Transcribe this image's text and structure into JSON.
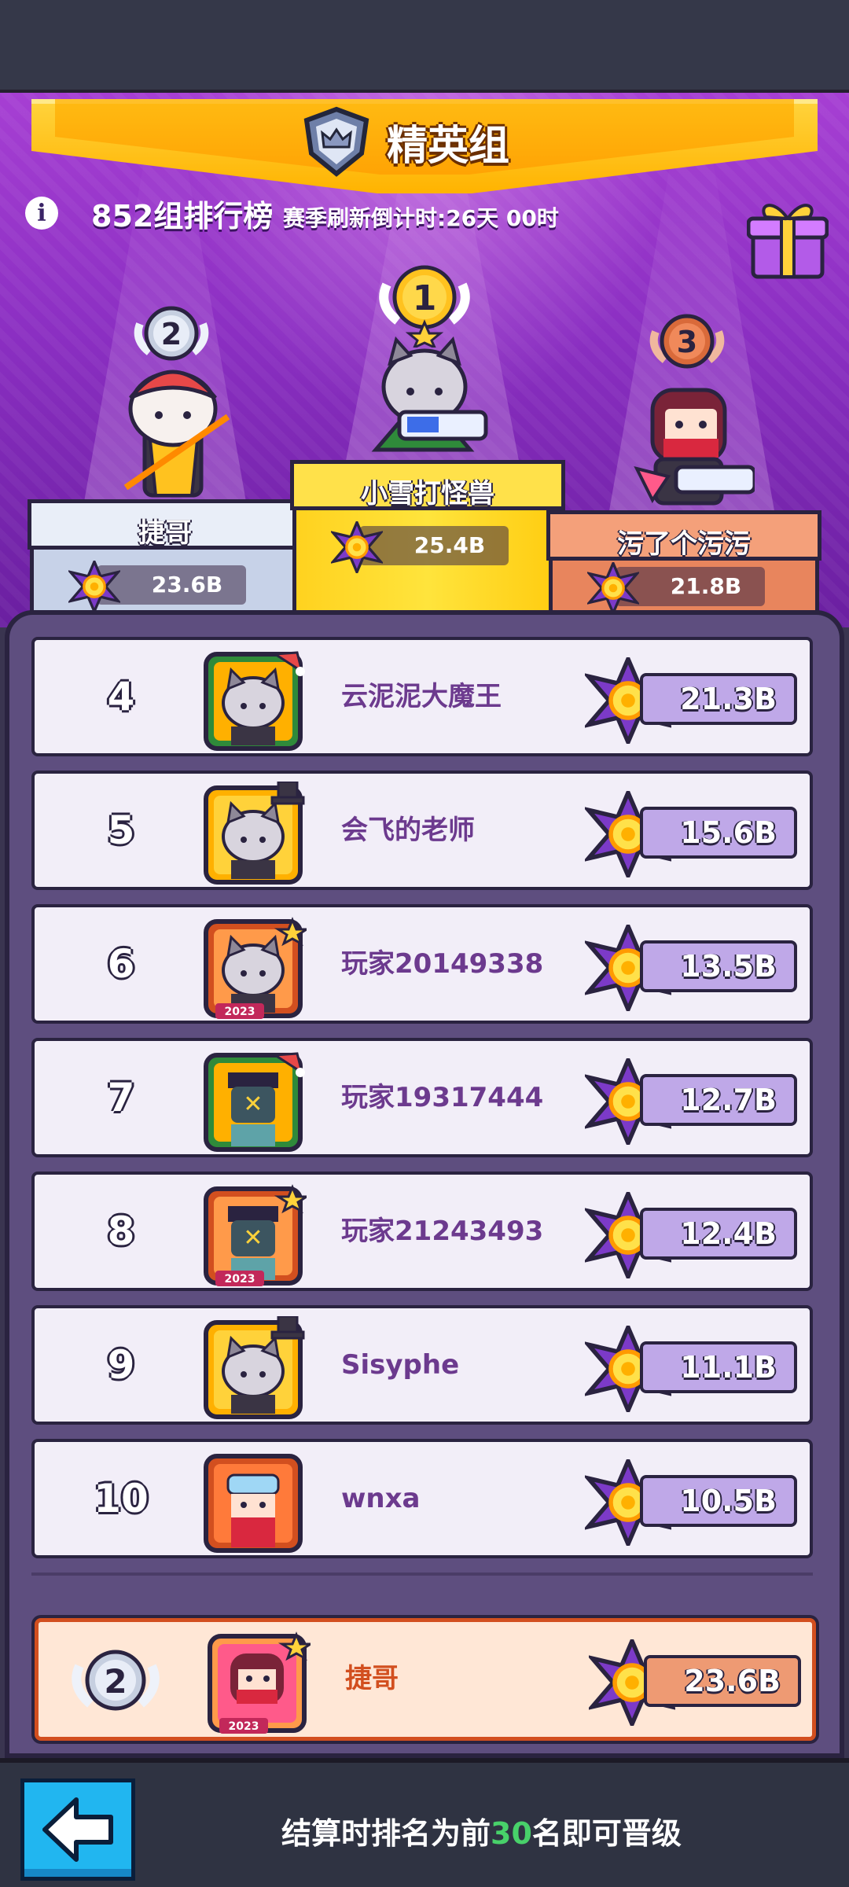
{
  "header": {
    "banner_title": "精英组",
    "rank_title": "852组排行榜",
    "countdown": "赛季刷新倒计时:26天 00时"
  },
  "podium": [
    {
      "place": "2",
      "name": "捷哥",
      "score": "23.6B"
    },
    {
      "place": "1",
      "name": "小雪打怪兽",
      "score": "25.4B"
    },
    {
      "place": "3",
      "name": "污了个污污",
      "score": "21.8B"
    }
  ],
  "leaderboard": [
    {
      "rank": "4",
      "name": "云泥泥大魔王",
      "score": "21.3B",
      "avatar": "cat-avatar-santa-hat"
    },
    {
      "rank": "5",
      "name": "会飞的老师",
      "score": "15.6B",
      "avatar": "cat-avatar-top-hat"
    },
    {
      "rank": "6",
      "name": "玩家20149338",
      "score": "13.5B",
      "avatar": "cat-avatar-2023"
    },
    {
      "rank": "7",
      "name": "玩家19317444",
      "score": "12.7B",
      "avatar": "pirate-avatar-santa-hat"
    },
    {
      "rank": "8",
      "name": "玩家21243493",
      "score": "12.4B",
      "avatar": "pirate-avatar-2023"
    },
    {
      "rank": "9",
      "name": "Sisyphe",
      "score": "11.1B",
      "avatar": "cat-avatar-top-hat"
    },
    {
      "rank": "10",
      "name": "wnxa",
      "score": "10.5B",
      "avatar": "goggles-avatar"
    }
  ],
  "self": {
    "rank": "2",
    "name": "捷哥",
    "score": "23.6B"
  },
  "footer": {
    "text_before": "结算时排名为前",
    "highlight": "30",
    "text_after": "名即可晋级"
  },
  "colors": {
    "stage_purple": "#8b2fc2",
    "banner_gold": "#ffb300",
    "row_bg": "#f2eef8",
    "name_purple": "#6c3a8e",
    "score_pill": "#bfa8e8",
    "self_accent": "#d24f1f",
    "highlight_green": "#48d16a",
    "back_button": "#21b6f0"
  }
}
